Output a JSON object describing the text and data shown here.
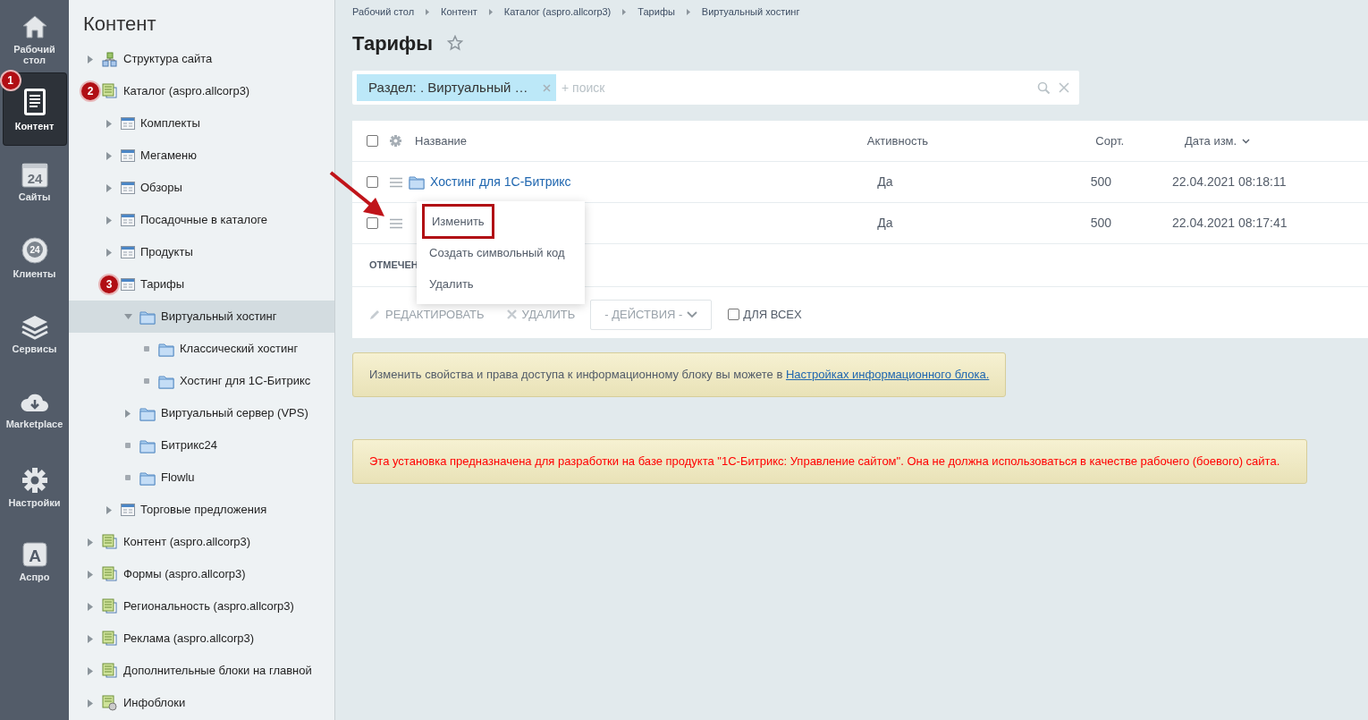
{
  "nav": [
    {
      "label": "Рабочий стол",
      "selected": false
    },
    {
      "label": "Контент",
      "selected": true,
      "badge": "1"
    },
    {
      "label": "Сайты",
      "icon_text": "24",
      "selected": false
    },
    {
      "label": "Клиенты",
      "icon_text": "24",
      "selected": false
    },
    {
      "label": "Сервисы",
      "selected": false
    },
    {
      "label": "Marketplace",
      "selected": false
    },
    {
      "label": "Настройки",
      "selected": false
    },
    {
      "label": "Аспро",
      "icon_text": "A",
      "selected": false
    }
  ],
  "tree": {
    "title": "Контент",
    "items": [
      {
        "label": "Структура сайта",
        "kind": "structure",
        "expanded": false,
        "selected": false
      },
      {
        "label": "Каталог (aspro.allcorp3)",
        "kind": "iblock-type",
        "badge": "2",
        "selected": false,
        "children": [
          {
            "label": "Комплекты",
            "kind": "iblock",
            "expanded": false,
            "selected": false
          },
          {
            "label": "Мегаменю",
            "kind": "iblock",
            "expanded": false,
            "selected": false
          },
          {
            "label": "Обзоры",
            "kind": "iblock",
            "expanded": false,
            "selected": false
          },
          {
            "label": "Посадочные в каталоге",
            "kind": "iblock",
            "expanded": false,
            "selected": false
          },
          {
            "label": "Продукты",
            "kind": "iblock",
            "expanded": false,
            "selected": false
          },
          {
            "label": "Тарифы",
            "kind": "iblock",
            "badge": "3",
            "selected": false,
            "children": [
              {
                "label": "Виртуальный хостинг",
                "kind": "folder",
                "expanded": true,
                "selected": true,
                "children": [
                  {
                    "label": "Классический хостинг",
                    "kind": "folder",
                    "selected": false
                  },
                  {
                    "label": "Хостинг для 1С-Битрикс",
                    "kind": "folder",
                    "selected": false
                  }
                ]
              },
              {
                "label": "Виртуальный сервер (VPS)",
                "kind": "folder",
                "expanded": false,
                "selected": false
              },
              {
                "label": "Битрикс24",
                "kind": "folder",
                "selected": false
              },
              {
                "label": "Flowlu",
                "kind": "folder",
                "selected": false
              }
            ]
          },
          {
            "label": "Торговые предложения",
            "kind": "iblock",
            "expanded": false,
            "selected": false
          }
        ]
      },
      {
        "label": "Контент (aspro.allcorp3)",
        "kind": "iblock-type",
        "expanded": false,
        "selected": false
      },
      {
        "label": "Формы (aspro.allcorp3)",
        "kind": "iblock-type",
        "expanded": false,
        "selected": false
      },
      {
        "label": "Региональность (aspro.allcorp3)",
        "kind": "iblock-type",
        "expanded": false,
        "selected": false
      },
      {
        "label": "Реклама (aspro.allcorp3)",
        "kind": "iblock-type",
        "expanded": false,
        "selected": false
      },
      {
        "label": "Дополнительные блоки на главной",
        "kind": "iblock-type",
        "expanded": false,
        "selected": false
      },
      {
        "label": "Инфоблоки",
        "kind": "iblocks",
        "expanded": false,
        "selected": false
      }
    ]
  },
  "breadcrumbs": [
    "Рабочий стол",
    "Контент",
    "Каталог (aspro.allcorp3)",
    "Тарифы",
    "Виртуальный хостинг"
  ],
  "page_title": "Тарифы",
  "favorite": false,
  "filter": {
    "chip": "Раздел: . Виртуальный …",
    "placeholder": "+ поиск"
  },
  "table": {
    "all_checked": false,
    "columns": [
      {
        "label": "Название",
        "sorted": false
      },
      {
        "label": "Активность",
        "sorted": false
      },
      {
        "label": "Сорт.",
        "sorted": false
      },
      {
        "label": "Дата изм.",
        "sorted": true
      }
    ],
    "rows": [
      {
        "name": "Хостинг для 1С-Битрикс",
        "active": "Да",
        "sort": "500",
        "date": "22.04.2021 08:18:11",
        "checked": false
      },
      {
        "active": "Да",
        "sort": "500",
        "date": "22.04.2021 08:17:41",
        "checked": false
      }
    ],
    "selection_label": "ОТМЕЧЕН",
    "actions": {
      "edit": "РЕДАКТИРОВАТЬ",
      "delete": "УДАЛИТЬ",
      "dropdown": "- ДЕЙСТВИЯ -",
      "for_all": "ДЛЯ ВСЕХ",
      "for_all_checked": false,
      "disabled": true
    }
  },
  "context_menu": [
    {
      "label": "Изменить",
      "highlighted": true
    },
    {
      "label": "Создать символьный код",
      "highlighted": false
    },
    {
      "label": "Удалить",
      "highlighted": false
    }
  ],
  "notices": [
    {
      "kind": "info",
      "text": "Изменить свойства и права доступа к информационному блоку вы можете в ",
      "link": "Настройках информационного блока."
    },
    {
      "kind": "warning",
      "text": "Эта установка предназначена для разработки на базе продукта \"1С-Битрикс: Управление сайтом\". Она не должна использоваться в качестве рабочего (боевого) сайта."
    }
  ]
}
